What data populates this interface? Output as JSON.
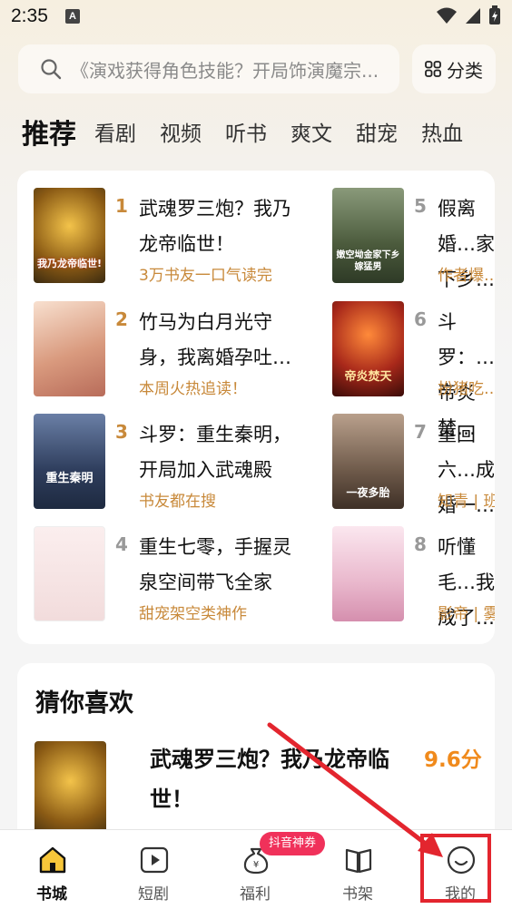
{
  "status_bar": {
    "time": "2:35",
    "notification_badge": "A"
  },
  "search": {
    "placeholder": "《演戏获得角色技能？开局饰演魔宗...",
    "category_label": "分类"
  },
  "tabs": [
    {
      "label": "推荐",
      "active": true
    },
    {
      "label": "看剧"
    },
    {
      "label": "视频"
    },
    {
      "label": "听书"
    },
    {
      "label": "爽文"
    },
    {
      "label": "甜宠"
    },
    {
      "label": "热血"
    }
  ],
  "ranking": {
    "items": [
      {
        "rank": "1",
        "title": "武魂罗三炮？我乃龙帝临世！",
        "subtitle": "3万书友一口气读完",
        "cover_text": "我乃龙帝临世!",
        "cover_color": "#6b4a1a"
      },
      {
        "rank": "2",
        "title": "竹马为白月光守身，我离婚孕吐…",
        "subtitle": "本周火热追读！",
        "cover_text": "",
        "cover_color": "#e7c7b2"
      },
      {
        "rank": "3",
        "title": "斗罗：重生秦明，开局加入武魂殿",
        "subtitle": "书友都在搜",
        "cover_text": "重生秦明",
        "cover_color": "#3a4d6e"
      },
      {
        "rank": "4",
        "title": "重生七零，手握灵泉空间带飞全家",
        "subtitle": "甜宠架空类神作",
        "cover_text": "",
        "cover_color": "#f4e6e6"
      },
      {
        "rank": "5",
        "title": "假离婚…家下乡…",
        "subtitle": "作者爆…",
        "cover_text": "嫩空坳金家下乡嫁猛男",
        "cover_color": "#5b6a4a"
      },
      {
        "rank": "6",
        "title": "斗罗：…帝炎焚…",
        "subtitle": "扮猪吃…",
        "cover_text": "帝炎焚天",
        "cover_color": "#7a1f12"
      },
      {
        "rank": "7",
        "title": "重回六…成婚一…",
        "subtitle": "知青 | 班…",
        "cover_text": "一夜多胎",
        "cover_color": "#6e5a4a"
      },
      {
        "rank": "8",
        "title": "听懂毛…我成了…",
        "subtitle": "影帝 | 雾…",
        "cover_text": "",
        "cover_color": "#f2d8e4"
      }
    ],
    "rank_colors": {
      "top3": "#c8893a",
      "other": "#999999"
    }
  },
  "guess": {
    "heading": "猜你喜欢",
    "book": {
      "title": "武魂罗三炮？我乃龙帝临世！",
      "score": "9.6分"
    }
  },
  "bottom_nav": [
    {
      "label": "书城",
      "icon": "bookstore-icon",
      "active": true
    },
    {
      "label": "短剧",
      "icon": "play-icon"
    },
    {
      "label": "福利",
      "icon": "money-bag-icon"
    },
    {
      "label": "书架",
      "icon": "bookshelf-icon"
    },
    {
      "label": "我的",
      "icon": "profile-icon"
    }
  ],
  "promo_badge": "抖音神券",
  "annotation_color": "#e3252e"
}
